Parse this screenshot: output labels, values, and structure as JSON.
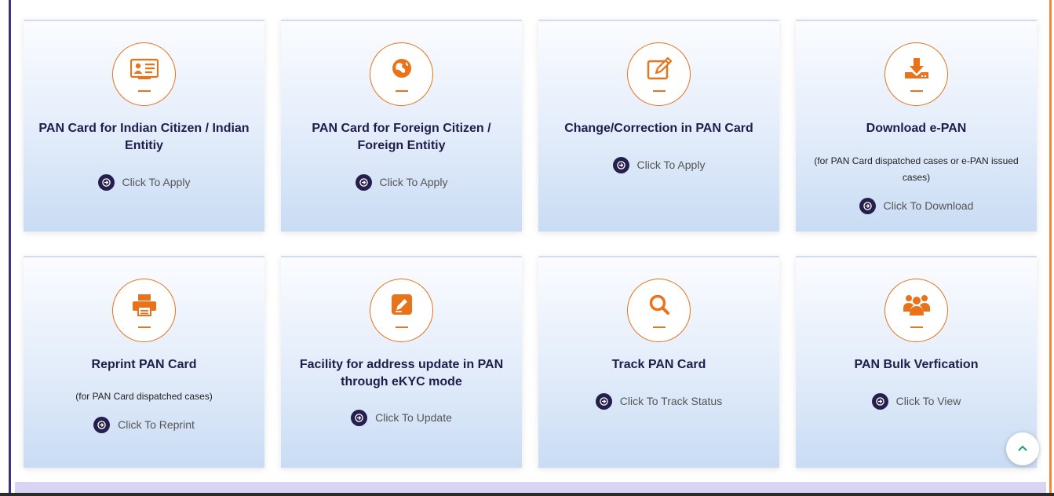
{
  "cards": [
    {
      "title": "PAN Card for Indian Citizen / Indian Entitiy",
      "note": "",
      "action": "Click To Apply",
      "icon": "id-card-icon"
    },
    {
      "title": "PAN Card for Foreign Citizen / Foreign Entitiy",
      "note": "",
      "action": "Click To Apply",
      "icon": "globe-icon"
    },
    {
      "title": "Change/Correction in PAN Card",
      "note": "",
      "action": "Click To Apply",
      "icon": "edit-icon"
    },
    {
      "title": "Download e-PAN",
      "note": "(for PAN Card dispatched cases or e-PAN issued cases)",
      "action": "Click To Download",
      "icon": "download-icon"
    },
    {
      "title": "Reprint PAN Card",
      "note": "(for PAN Card dispatched cases)",
      "action": "Click To Reprint",
      "icon": "printer-icon"
    },
    {
      "title": "Facility for address update in PAN through eKYC mode",
      "note": "",
      "action": "Click To Update",
      "icon": "pencil-square-icon"
    },
    {
      "title": "Track PAN Card",
      "note": "",
      "action": "Click To Track Status",
      "icon": "search-icon"
    },
    {
      "title": "PAN Bulk Verfication",
      "note": "",
      "action": "Click To View",
      "icon": "users-icon"
    }
  ],
  "colors": {
    "accent": "#e8731a",
    "navy": "#241f4d",
    "title": "#1f1d4a"
  }
}
